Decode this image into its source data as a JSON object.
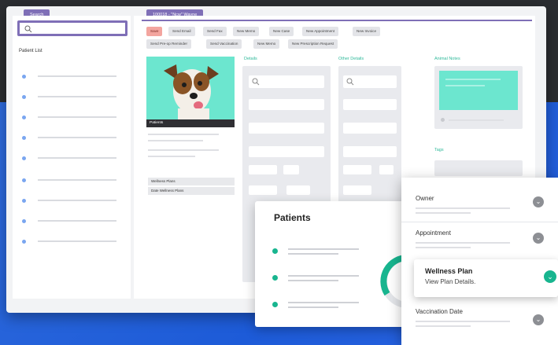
{
  "tabs": {
    "search": "Search",
    "record": "100018 - \"Ncw\" Wayne"
  },
  "left": {
    "patient_list_label": "Patient List"
  },
  "toolbar": {
    "row1": [
      "Save",
      "Send Email",
      "Send Fax",
      "New Memo",
      "New Case",
      "New Appointment",
      "New Invoice"
    ],
    "row2": [
      "Send Pre-op Reminder",
      "Send Vaccination",
      "New Memo",
      "New Prescription Request"
    ]
  },
  "columns": {
    "details": "Details",
    "other_details": "Other Details",
    "animal_notes": "Animal Notes",
    "tags": "Tags"
  },
  "patient_caption": "Patients",
  "wellness": {
    "plans": "Wellness Plans",
    "date_plans": "Date Wellness Plans"
  },
  "patients_card": {
    "title": "Patients"
  },
  "owner_card": {
    "owner": "Owner",
    "appointment": "Appointment",
    "wellness_title": "Wellness Plan",
    "wellness_sub": "View Plan Details.",
    "vaccination": "Vaccination Date"
  },
  "colors": {
    "accent": "#7f6fb7",
    "teal": "#6ce6cf",
    "green": "#18b58f",
    "blue": "#2f6bdc"
  }
}
